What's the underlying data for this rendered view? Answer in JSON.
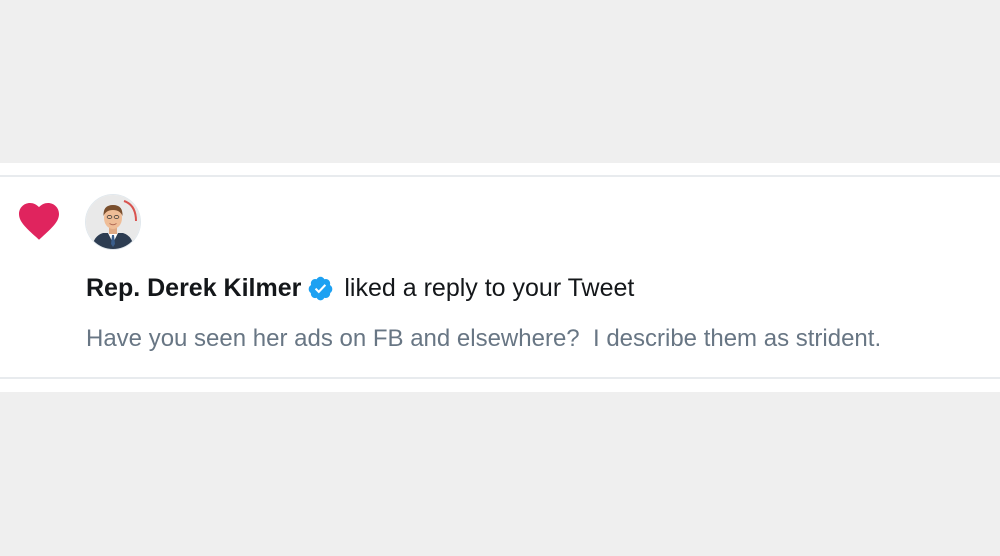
{
  "notification": {
    "user_name": "Rep. Derek Kilmer",
    "action_text": "liked a reply to your Tweet",
    "tweet_text": "Have you seen her ads on FB and elsewhere?  I describe them as strident.",
    "icons": {
      "type_icon": "heart-icon",
      "badge": "verified-badge-icon"
    },
    "colors": {
      "heart": "#e0245e",
      "verified": "#1da1f2",
      "name": "#14171a",
      "secondary_text": "#687684"
    }
  }
}
